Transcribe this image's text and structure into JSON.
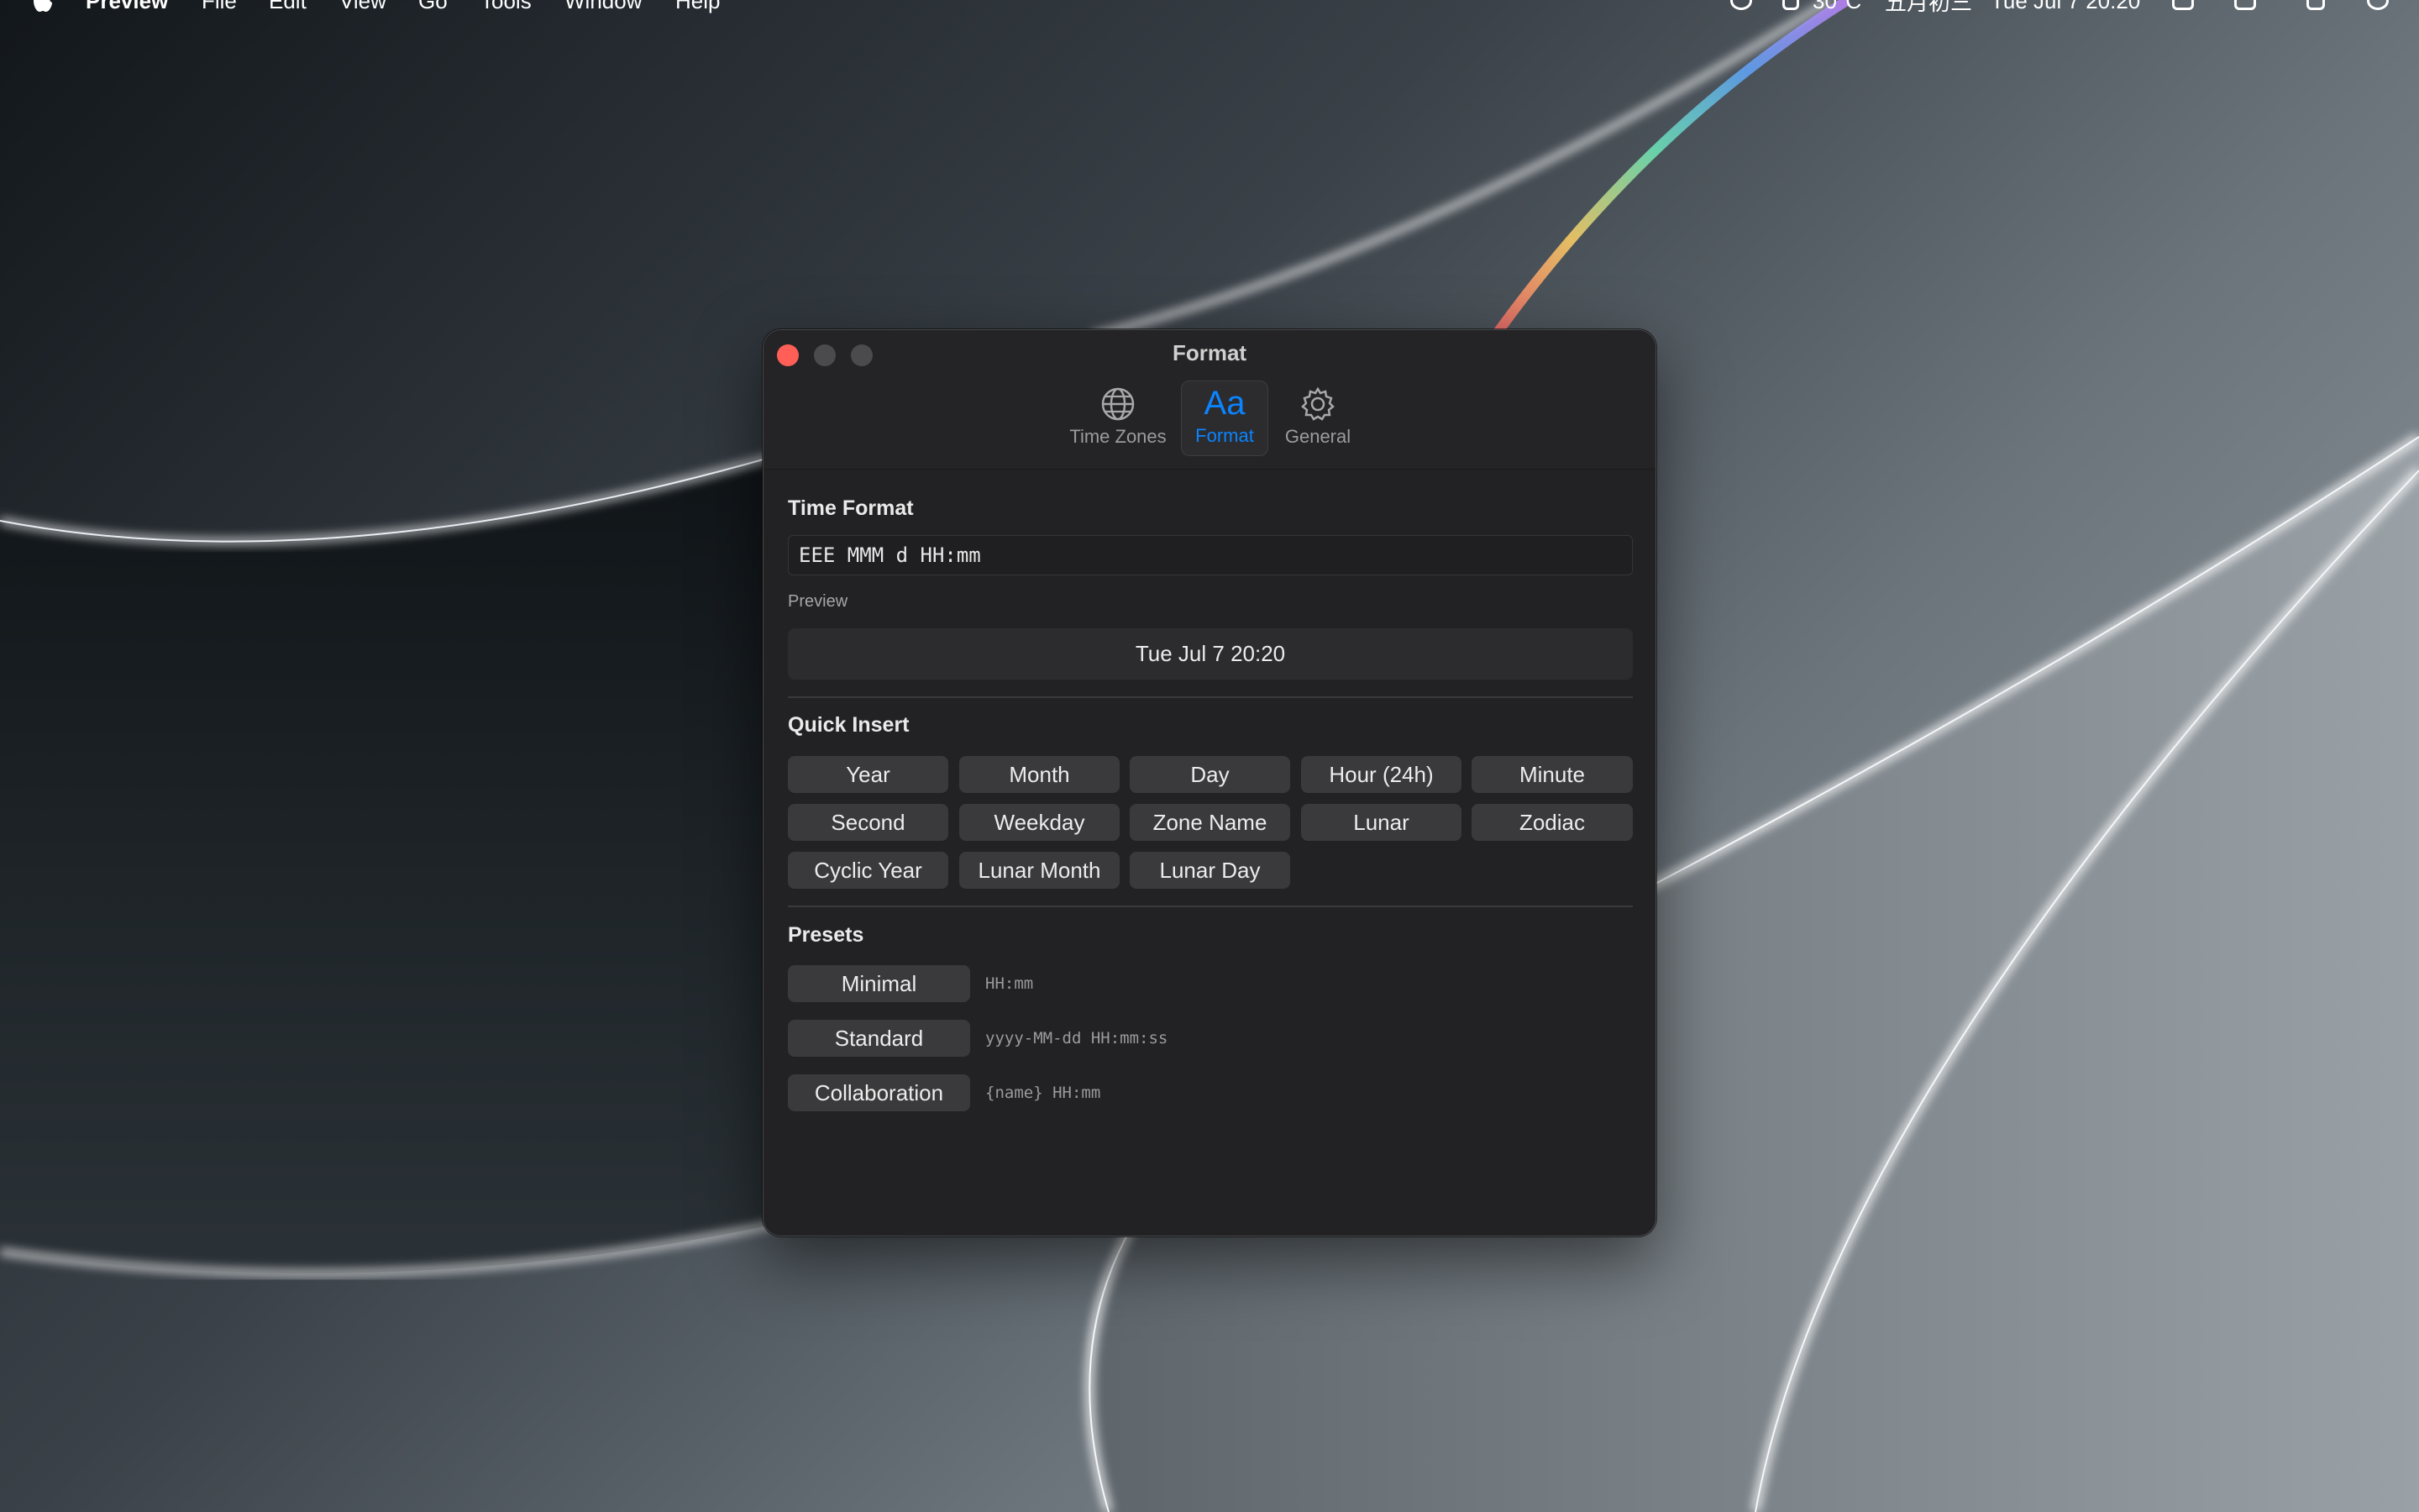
{
  "menubar": {
    "app_name": "Preview",
    "items": [
      "File",
      "Edit",
      "View",
      "Go",
      "Tools",
      "Window",
      "Help"
    ],
    "status": {
      "temperature": "30°C",
      "lunar_date": "五月初三",
      "datetime": "Tue Jul 7 20:20"
    }
  },
  "window": {
    "title": "Format",
    "tabs": [
      {
        "label": "Time Zones",
        "icon": "globe-icon"
      },
      {
        "label": "Format",
        "icon": "aa-icon",
        "glyph": "Aa",
        "active": true
      },
      {
        "label": "General",
        "icon": "gear-icon"
      }
    ],
    "accent_color": "#0a84ff"
  },
  "time_format": {
    "title": "Time Format",
    "value": "EEE MMM d HH:mm",
    "preview_label": "Preview",
    "preview_value": "Tue Jul 7 20:20"
  },
  "quick_insert": {
    "title": "Quick Insert",
    "buttons": [
      "Year",
      "Month",
      "Day",
      "Hour (24h)",
      "Minute",
      "Second",
      "Weekday",
      "Zone Name",
      "Lunar",
      "Zodiac",
      "Cyclic Year",
      "Lunar Month",
      "Lunar Day"
    ]
  },
  "presets": {
    "title": "Presets",
    "items": [
      {
        "label": "Minimal",
        "pattern": "HH:mm"
      },
      {
        "label": "Standard",
        "pattern": "yyyy-MM-dd HH:mm:ss"
      },
      {
        "label": "Collaboration",
        "pattern": "{name} HH:mm"
      }
    ]
  }
}
